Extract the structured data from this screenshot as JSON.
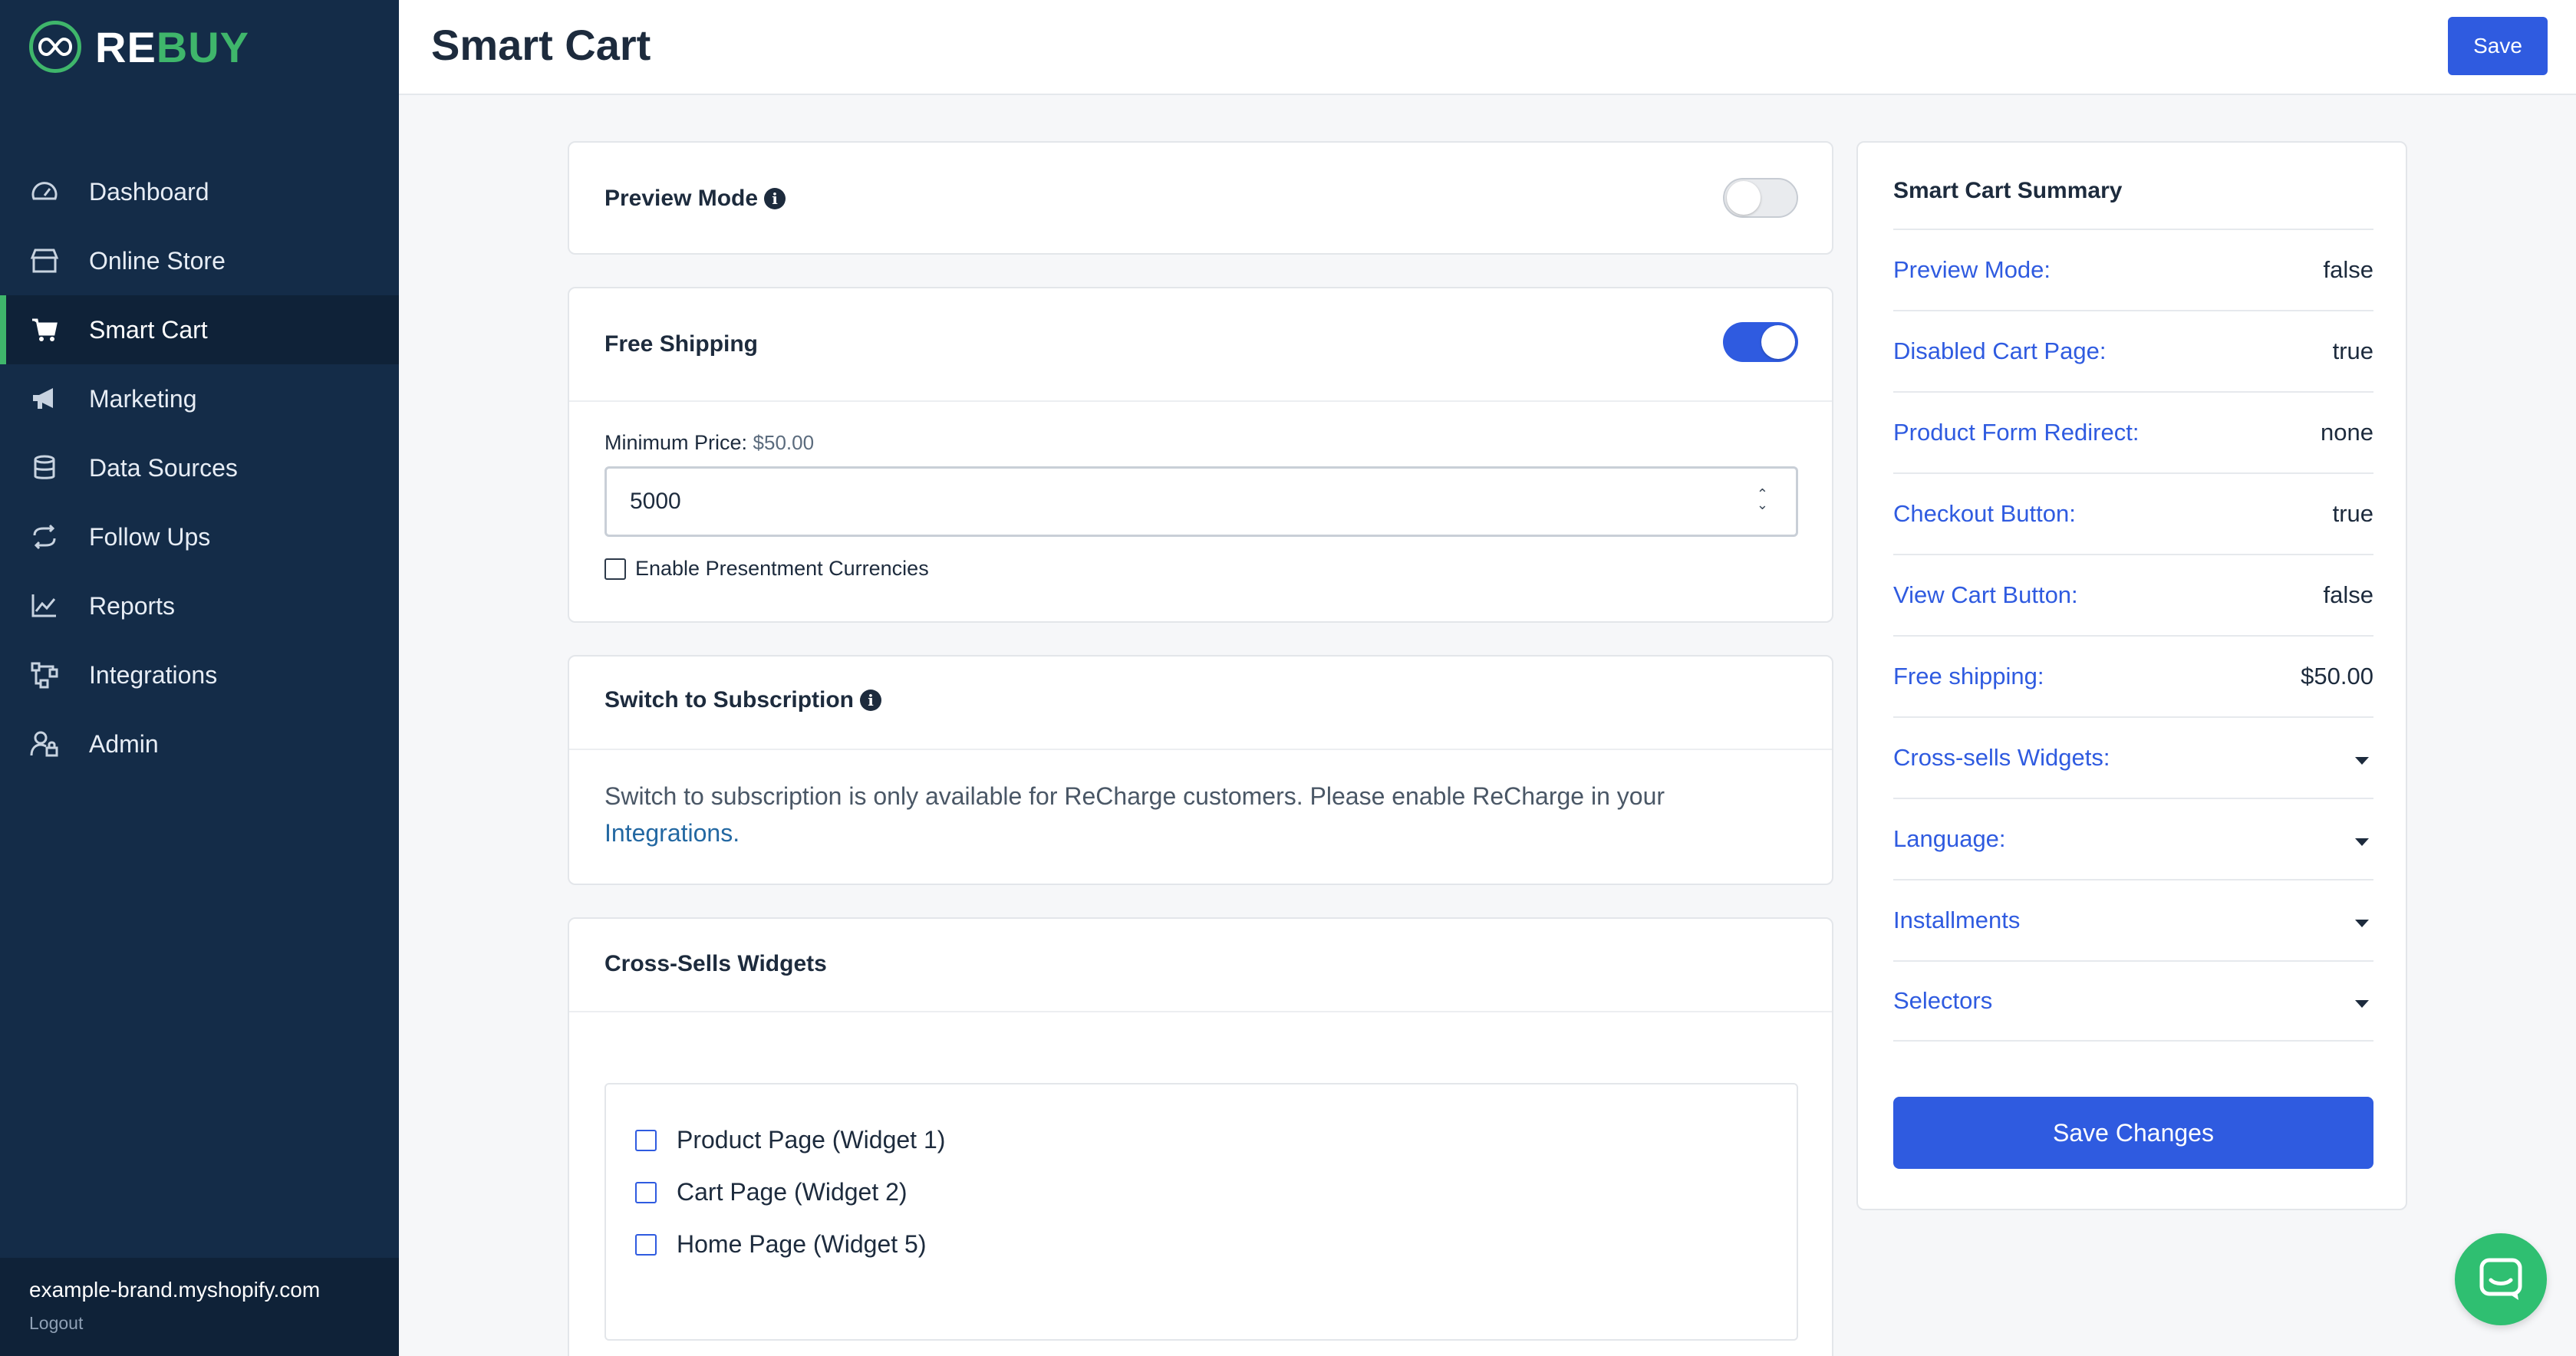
{
  "app": {
    "logo_re": "RE",
    "logo_buy": "BUY",
    "accent": "#3fb66b",
    "primary": "#2f5be0"
  },
  "sidebar": {
    "items": [
      {
        "label": "Dashboard",
        "icon": "gauge-icon"
      },
      {
        "label": "Online Store",
        "icon": "store-icon"
      },
      {
        "label": "Smart Cart",
        "icon": "cart-icon",
        "active": true
      },
      {
        "label": "Marketing",
        "icon": "megaphone-icon"
      },
      {
        "label": "Data Sources",
        "icon": "database-icon"
      },
      {
        "label": "Follow Ups",
        "icon": "repeat-icon"
      },
      {
        "label": "Reports",
        "icon": "chart-line-icon"
      },
      {
        "label": "Integrations",
        "icon": "network-icon"
      },
      {
        "label": "Admin",
        "icon": "user-lock-icon"
      }
    ],
    "footer": {
      "store_url": "example-brand.myshopify.com",
      "logout_label": "Logout"
    }
  },
  "header": {
    "title": "Smart Cart",
    "save_label": "Save"
  },
  "preview_mode": {
    "title": "Preview Mode",
    "enabled": false
  },
  "free_shipping": {
    "title": "Free Shipping",
    "enabled": true,
    "min_price_label": "Minimum Price:",
    "min_price_display": "$50.00",
    "min_price_value": "5000",
    "presentment_label": "Enable Presentment Currencies"
  },
  "subscription": {
    "title": "Switch to Subscription",
    "message": "Switch to subscription is only available for ReCharge customers. Please enable ReCharge in your",
    "link_label": "Integrations."
  },
  "cross_sells": {
    "title": "Cross-Sells Widgets",
    "widgets": [
      {
        "label": "Product Page (Widget 1)",
        "checked": false
      },
      {
        "label": "Cart Page (Widget 2)",
        "checked": false
      },
      {
        "label": "Home Page (Widget 5)",
        "checked": false
      }
    ]
  },
  "summary": {
    "title": "Smart Cart Summary",
    "rows": [
      {
        "key": "Preview Mode:",
        "value": "false"
      },
      {
        "key": "Disabled Cart Page:",
        "value": "true"
      },
      {
        "key": "Product Form Redirect:",
        "value": "none"
      },
      {
        "key": "Checkout Button:",
        "value": "true"
      },
      {
        "key": "View Cart Button:",
        "value": "false"
      },
      {
        "key": "Free shipping:",
        "value": "$50.00"
      },
      {
        "key": "Cross-sells Widgets:",
        "value": ""
      },
      {
        "key": "Language:",
        "value": ""
      },
      {
        "key": "Installments",
        "value": ""
      },
      {
        "key": "Selectors",
        "value": ""
      }
    ],
    "save_changes_label": "Save Changes"
  }
}
